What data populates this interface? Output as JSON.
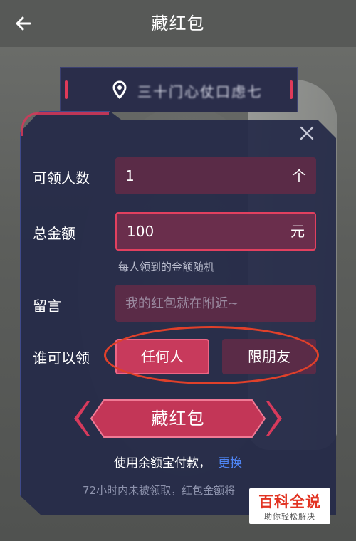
{
  "header": {
    "title": "藏红包",
    "back_icon": "back-arrow-icon"
  },
  "location": {
    "icon": "location-pin-icon",
    "text": "三十门心仗口虑七"
  },
  "form": {
    "close_icon": "close-icon",
    "recipients": {
      "label": "可领人数",
      "value": "1",
      "unit": "个"
    },
    "amount": {
      "label": "总金额",
      "value": "100",
      "unit": "元",
      "hint": "每人领到的金额随机"
    },
    "message": {
      "label": "留言",
      "placeholder": "我的红包就在附近~",
      "value": ""
    },
    "who_can_claim": {
      "label": "谁可以领",
      "options": [
        {
          "label": "任何人",
          "selected": true
        },
        {
          "label": "限朋友",
          "selected": false
        }
      ]
    },
    "submit_label": "藏红包",
    "payment": {
      "text": "使用余额宝付款，",
      "link": "更换"
    },
    "notice": "72小时内未被领取，红包金额将"
  },
  "watermark": {
    "title": "百科全说",
    "subtitle": "助你轻松解决"
  },
  "colors": {
    "accent": "#e2405f",
    "panel": "#252a48",
    "link": "#4f86f7",
    "annotation": "#e0402a"
  }
}
